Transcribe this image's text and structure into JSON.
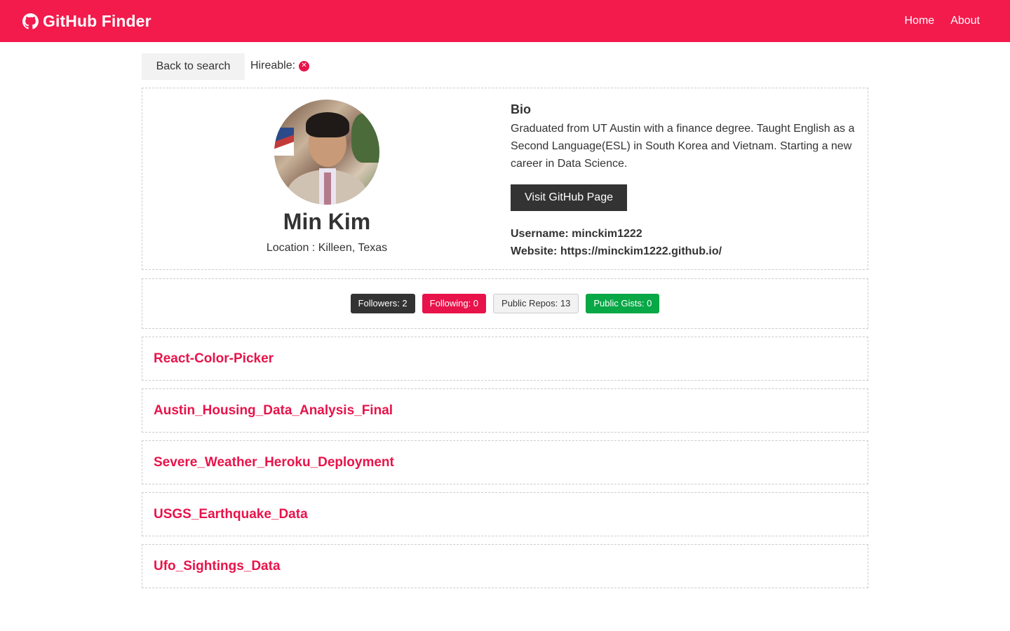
{
  "navbar": {
    "title": "GitHub Finder",
    "icon": "github-icon",
    "links": [
      {
        "label": "Home"
      },
      {
        "label": "About"
      }
    ],
    "bg_color": "#f31a4c"
  },
  "topbar": {
    "back_label": "Back to search",
    "hireable_label": "Hireable:",
    "hireable_icon": "times-circle-icon"
  },
  "profile": {
    "name": "Min Kim",
    "location": "Location : Killeen, Texas",
    "bio_heading": "Bio",
    "bio": "Graduated from UT Austin with a finance degree. Taught English as a Second Language(ESL) in South Korea and Vietnam. Starting a new career in Data Science.",
    "visit_label": "Visit GitHub Page",
    "username": "Username: minckim1222",
    "website": "Website: https://minckim1222.github.io/"
  },
  "stats": {
    "followers": "Followers: 2",
    "following": "Following: 0",
    "repos": "Public Repos: 13",
    "gists": "Public Gists: 0"
  },
  "repos": [
    {
      "name": "React-Color-Picker"
    },
    {
      "name": "Austin_Housing_Data_Analysis_Final"
    },
    {
      "name": "Severe_Weather_Heroku_Deployment"
    },
    {
      "name": "USGS_Earthquake_Data"
    },
    {
      "name": "Ufo_Sightings_Data"
    }
  ],
  "colors": {
    "primary": "#e8134a",
    "dark": "#333333",
    "success": "#08a846",
    "light": "#f2f2f2"
  }
}
